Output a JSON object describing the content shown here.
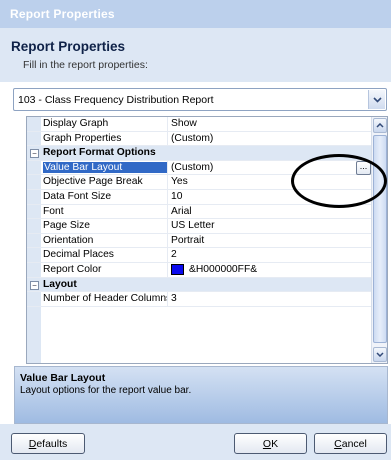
{
  "window": {
    "title": "Report Properties"
  },
  "header": {
    "title": "Report Properties",
    "subtitle": "Fill in the report properties:"
  },
  "report_select": {
    "selected": "103 - Class Frequency Distribution Report"
  },
  "properties": [
    {
      "kind": "row",
      "name": "Display Graph",
      "value": "Show"
    },
    {
      "kind": "row",
      "name": "Graph Properties",
      "value": "(Custom)"
    },
    {
      "kind": "category",
      "name": "Report Format Options",
      "toggle": "−"
    },
    {
      "kind": "row",
      "name": "Value Bar Layout",
      "value": "(Custom)",
      "selected": true,
      "ellipsis": "..."
    },
    {
      "kind": "row",
      "name": "Objective Page Break",
      "value": "Yes"
    },
    {
      "kind": "row",
      "name": "Data Font Size",
      "value": "10"
    },
    {
      "kind": "row",
      "name": "Font",
      "value": "Arial"
    },
    {
      "kind": "row",
      "name": "Page Size",
      "value": "US Letter"
    },
    {
      "kind": "row",
      "name": "Orientation",
      "value": "Portrait"
    },
    {
      "kind": "row",
      "name": "Decimal Places",
      "value": "2"
    },
    {
      "kind": "row",
      "name": "Report Color",
      "value": "&H000000FF&",
      "swatch": "#0a0aee"
    },
    {
      "kind": "category",
      "name": "Layout",
      "toggle": "−"
    },
    {
      "kind": "row",
      "name": "Number of Header Columns",
      "value": "3"
    }
  ],
  "description": {
    "title": "Value Bar Layout",
    "text": "Layout options for the report value bar."
  },
  "buttons": {
    "defaults": {
      "first": "D",
      "rest": "efaults"
    },
    "ok": {
      "first": "O",
      "rest": "K"
    },
    "cancel": {
      "first": "C",
      "rest": "ancel"
    }
  },
  "colors": {
    "titlebar": "#bcd0ec",
    "header": "#dde7f4",
    "selection": "#3169c6",
    "report_color": "#0a0aee"
  },
  "icons": {
    "combo_arrow": "chevron-down-icon",
    "scroll_up": "chevron-up-icon",
    "scroll_down": "chevron-down-icon"
  }
}
